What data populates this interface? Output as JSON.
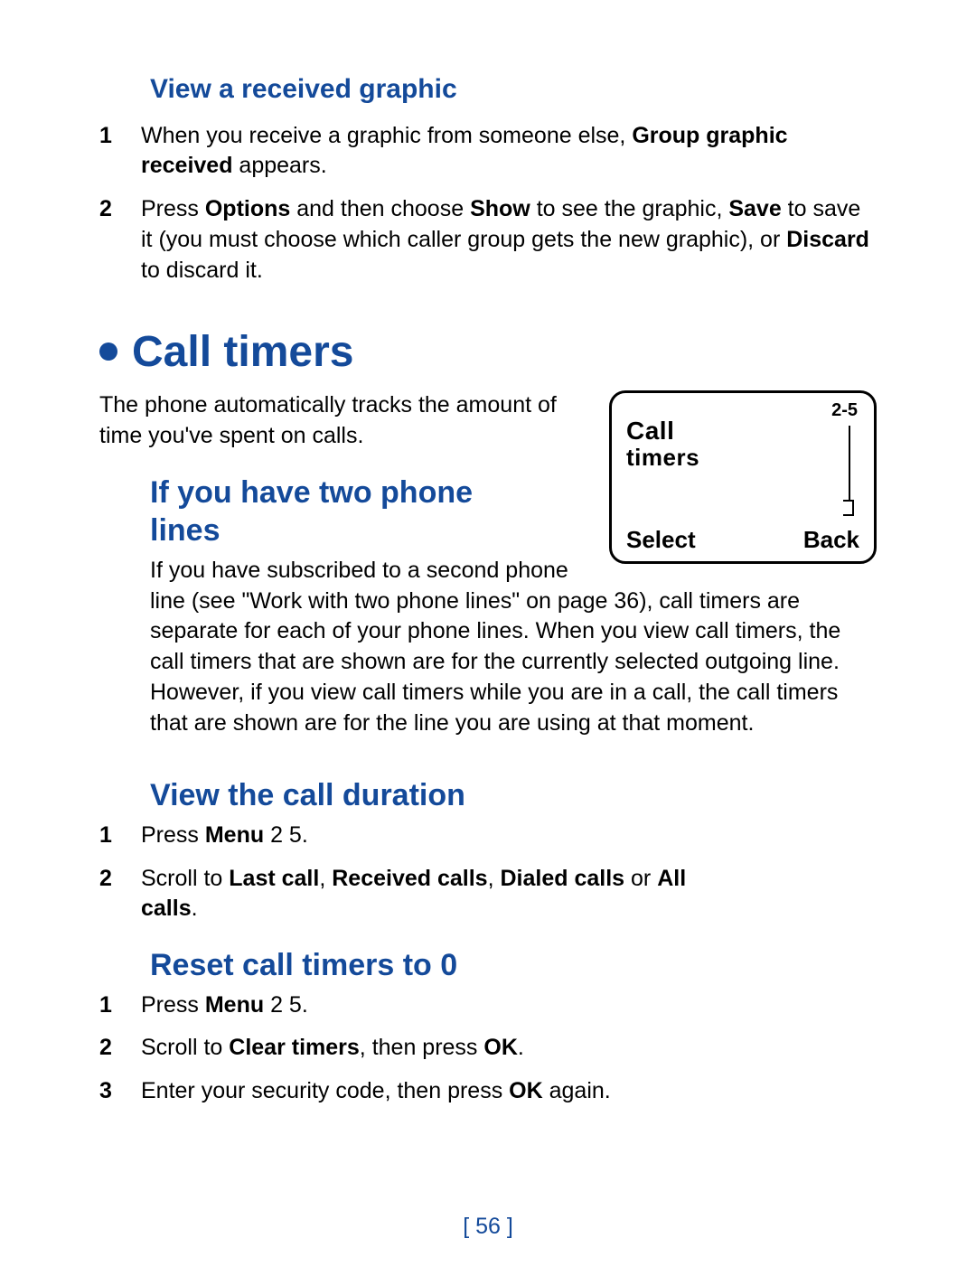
{
  "section1": {
    "title": "View a received graphic",
    "step1_pre": "When you receive a graphic from someone else, ",
    "step1_bold": "Group graphic received",
    "step1_post": " appears.",
    "step2_a": "Press ",
    "step2_b": "Options",
    "step2_c": " and then choose ",
    "step2_d": "Show",
    "step2_e": " to see the graphic, ",
    "step2_f": "Save",
    "step2_g": " to save it (you must choose which caller group gets the new graphic), or ",
    "step2_h": "Discard",
    "step2_i": " to discard it."
  },
  "h1": "Call timers",
  "intro": "The phone automatically tracks the amount of time you've spent on calls.",
  "screen": {
    "num": "2-5",
    "line1": "Call",
    "line2": "timers",
    "select": "Select",
    "back": "Back"
  },
  "section2": {
    "title": "If you have two phone lines",
    "body": "If you have subscribed to a second phone line (see \"Work with two phone lines\" on page 36), call timers are separate for each of your phone lines. When you view call timers, the call timers that are shown are for the currently selected outgoing line. However, if you view call timers while you are in a call, the call timers that are shown are for the line you are using at that moment."
  },
  "section3": {
    "title": "View the call duration",
    "s1_a": "Press ",
    "s1_b": "Menu",
    "s1_c": " 2 5.",
    "s2_a": "Scroll to ",
    "s2_b": "Last call",
    "s2_c": ", ",
    "s2_d": "Received calls",
    "s2_e": ", ",
    "s2_f": "Dialed calls",
    "s2_g": " or ",
    "s2_h": "All calls",
    "s2_i": "."
  },
  "section4": {
    "title": "Reset call timers to 0",
    "s1_a": "Press ",
    "s1_b": "Menu",
    "s1_c": " 2 5.",
    "s2_a": "Scroll to ",
    "s2_b": "Clear timers",
    "s2_c": ", then press ",
    "s2_d": "OK",
    "s2_e": ".",
    "s3_a": "Enter your security code, then press ",
    "s3_b": "OK",
    "s3_c": " again."
  },
  "page_number": "[ 56 ]",
  "nums": {
    "n1": "1",
    "n2": "2",
    "n3": "3"
  }
}
